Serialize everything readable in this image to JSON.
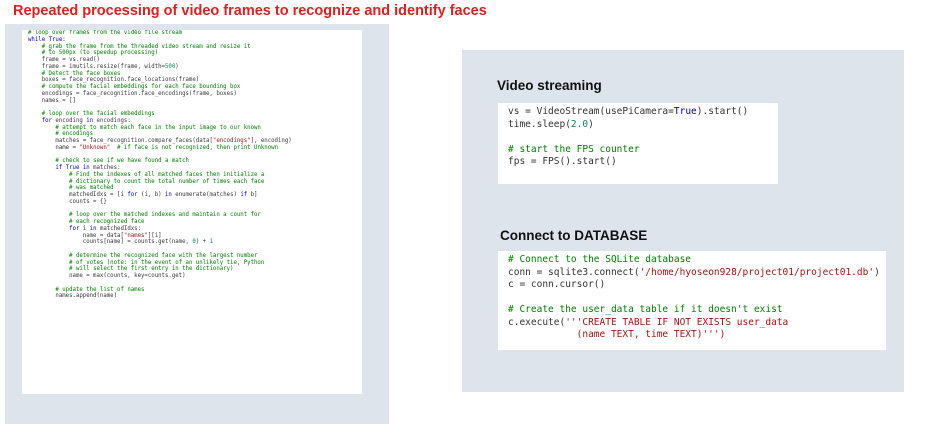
{
  "slide": {
    "title": "Repeated processing of video frames to recognize and identify faces"
  },
  "left_code": [
    "# loop over frames from the video file stream",
    "while True:",
    "    # grab the frame from the threaded video stream and resize it",
    "    # to 500px (to speedup processing)",
    "    frame = vs.read()",
    "    frame = imutils.resize(frame, width=500)",
    "    # Detect the face boxes",
    "    boxes = face_recognition.face_locations(frame)",
    "    # compute the facial embeddings for each face bounding box",
    "    encodings = face_recognition.face_encodings(frame, boxes)",
    "    names = []",
    "",
    "    # loop over the facial embeddings",
    "    for encoding in encodings:",
    "        # attempt to match each face in the input image to our known",
    "        # encodings",
    "        matches = face_recognition.compare_faces(data[\"encodings\"], encoding)",
    "        name = \"Unknown\"  # if face is not recognized, then print Unknown",
    "",
    "        # check to see if we have found a match",
    "        if True in matches:",
    "            # Find the indexes of all matched faces then initialize a",
    "            # dictionary to count the total number of times each face",
    "            # was matched",
    "            matchedIdxs = [i for (i, b) in enumerate(matches) if b]",
    "            counts = {}",
    "",
    "            # loop over the matched indexes and maintain a count for",
    "            # each recognized face",
    "            for i in matchedIdxs:",
    "                name = data[\"names\"][i]",
    "                counts[name] = counts.get(name, 0) + 1",
    "",
    "            # determine the recognized face with the largest number",
    "            # of votes (note: in the event of an unlikely tie, Python",
    "            # will select the first entry in the dictionary)",
    "            name = max(counts, key=counts.get)",
    "",
    "        # update the list of names",
    "        names.append(name)"
  ],
  "video_section": {
    "heading": "Video streaming",
    "code": [
      "vs = VideoStream(usePiCamera=True).start()",
      "time.sleep(2.0)",
      "",
      "# start the FPS counter",
      "fps = FPS().start()"
    ]
  },
  "db_section": {
    "heading": "Connect to DATABASE",
    "code": [
      "# Connect to the SQLite database",
      "conn = sqlite3.connect('/home/hyoseon928/project01/project01.db')",
      "c = conn.cursor()",
      "",
      "# Create the user_data table if it doesn't exist",
      "c.execute('''CREATE TABLE IF NOT EXISTS user_data",
      "            (name TEXT, time TEXT)''')"
    ]
  },
  "colors": {
    "title": "#e02020",
    "panel_bg": "#dde4ec",
    "keyword": "#0000cc",
    "comment": "#008000",
    "string": "#a31515",
    "number": "#098658"
  }
}
